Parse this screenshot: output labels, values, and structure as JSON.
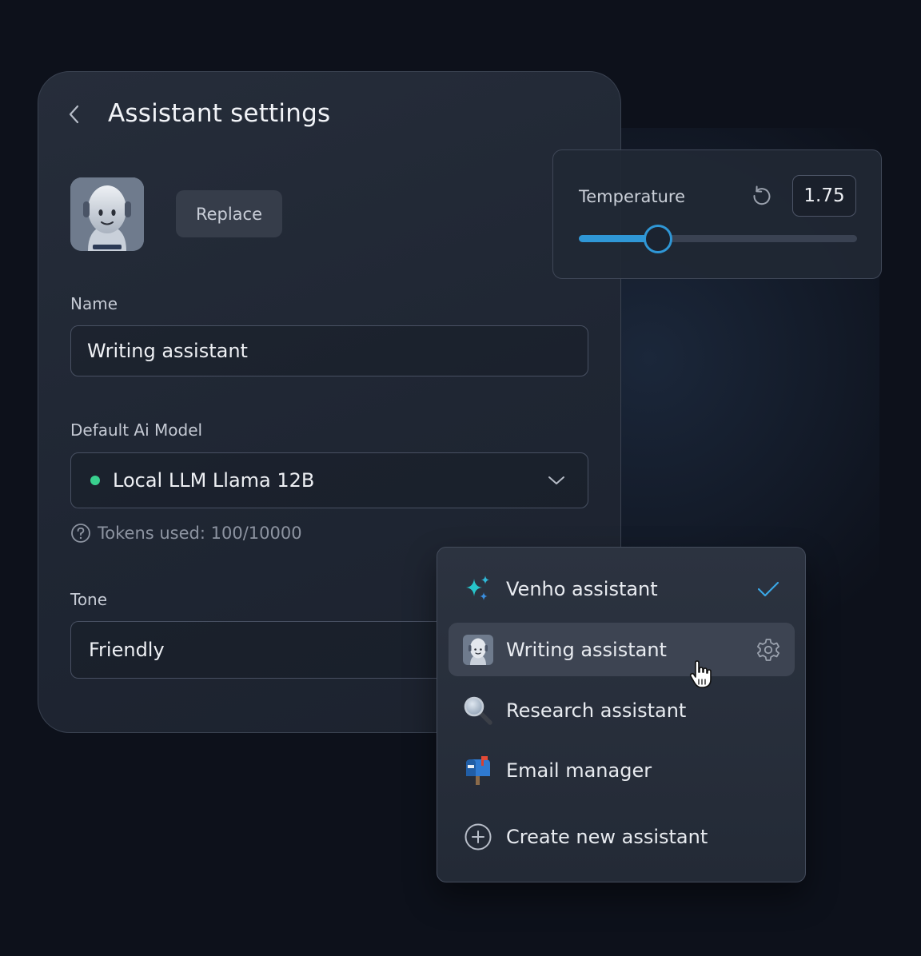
{
  "header": {
    "title": "Assistant settings",
    "back_icon": "chevron-left-icon"
  },
  "avatar": {
    "icon": "robot-avatar-icon"
  },
  "replace_label": "Replace",
  "name": {
    "label": "Name",
    "value": "Writing assistant"
  },
  "model": {
    "label": "Default Ai Model",
    "value": "Local LLM Llama 12B",
    "status_color": "#39d08e",
    "tokens_text": "Tokens used: 100/10000"
  },
  "tone": {
    "label": "Tone",
    "value": "Friendly"
  },
  "temperature": {
    "label": "Temperature",
    "value": "1.75",
    "slider_level": 0.28,
    "accent": "#2f97d6"
  },
  "assistant_menu": {
    "items": [
      {
        "label": "Venho assistant",
        "icon": "sparkles-icon",
        "selected": true
      },
      {
        "label": "Writing assistant",
        "icon": "robot-avatar-icon",
        "hovered": true,
        "right_icon": "gear-icon"
      },
      {
        "label": "Research assistant",
        "icon": "magnifier-icon"
      },
      {
        "label": "Email manager",
        "icon": "mailbox-icon"
      }
    ],
    "create_label": "Create new assistant"
  }
}
